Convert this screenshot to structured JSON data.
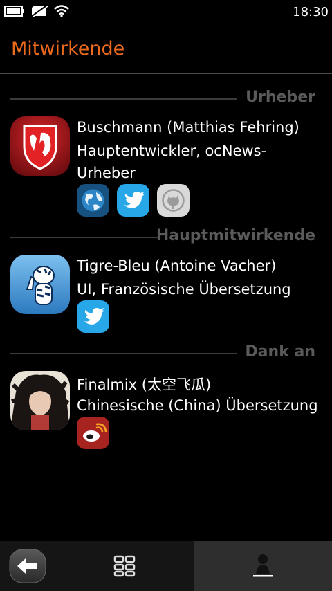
{
  "status": {
    "time": "18:30",
    "icons": [
      "battery-icon",
      "no-sim-icon",
      "wifi-icon"
    ]
  },
  "page": {
    "title": "Mitwirkende"
  },
  "colors": {
    "accent": "#ec6a1b",
    "section_label": "#5a5a5a"
  },
  "sections": [
    {
      "label": "Urheber",
      "person": {
        "name": "Buschmann (Matthias Fehring)",
        "role_lines": [
          "Hauptentwickler, ocNews-",
          "Urheber"
        ],
        "links": [
          "globe-icon",
          "twitter-icon",
          "github-icon"
        ]
      }
    },
    {
      "label": "Hauptmitwirkende",
      "person": {
        "name": "Tigre-Bleu (Antoine Vacher)",
        "role_lines": [
          "UI, Französische Übersetzung"
        ],
        "links": [
          "twitter-icon"
        ]
      }
    },
    {
      "label": "Dank an",
      "person": {
        "name": "Finalmix (太空飞瓜)",
        "role_lines": [
          "Chinesische (China) Übersetzung"
        ],
        "links": [
          "weibo-icon"
        ]
      }
    }
  ],
  "toolbar": {
    "buttons": [
      "back-arrow-icon",
      "app-grid-icon",
      "contributors-icon"
    ]
  }
}
